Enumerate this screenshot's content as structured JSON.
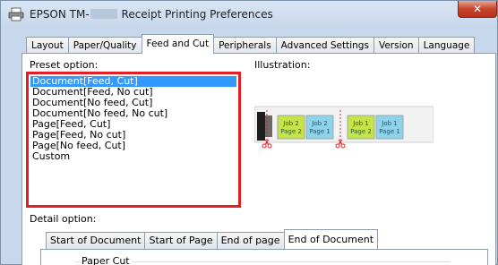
{
  "window": {
    "title_prefix": "EPSON TM-",
    "title_suffix": "Receipt Printing Preferences",
    "close_glyph": "✕",
    "app_icon": "printer-icon"
  },
  "tabs": [
    {
      "label": "Layout"
    },
    {
      "label": "Paper/Quality"
    },
    {
      "label": "Feed and Cut",
      "active": true
    },
    {
      "label": "Peripherals"
    },
    {
      "label": "Advanced Settings"
    },
    {
      "label": "Version"
    },
    {
      "label": "Language"
    }
  ],
  "preset": {
    "label": "Preset option:",
    "items": [
      "Document[Feed, Cut]",
      "Document[Feed, No cut]",
      "Document[No feed, Cut]",
      "Document[No feed, No cut]",
      "Page[Feed, Cut]",
      "Page[Feed, No cut]",
      "Page[No feed, Cut]",
      "Custom"
    ],
    "selected_index": 0,
    "highlight_color": "#e31e24"
  },
  "illustration": {
    "label": "Illustration:",
    "pages": [
      {
        "line1": "Job 2",
        "line2": "Page 2",
        "color": "#c8e34a"
      },
      {
        "line1": "Job 2",
        "line2": "Page 1",
        "color": "#8ed3ea"
      },
      {
        "line1": "Job 1",
        "line2": "Page 2",
        "color": "#c8e34a"
      },
      {
        "line1": "Job 1",
        "line2": "Page 1",
        "color": "#8ed3ea"
      }
    ]
  },
  "detail": {
    "label": "Detail option:",
    "tabs": [
      {
        "label": "Start of Document"
      },
      {
        "label": "Start of Page"
      },
      {
        "label": "End of page"
      },
      {
        "label": "End of Document",
        "active": true
      }
    ],
    "group_label": "Paper Cut"
  }
}
